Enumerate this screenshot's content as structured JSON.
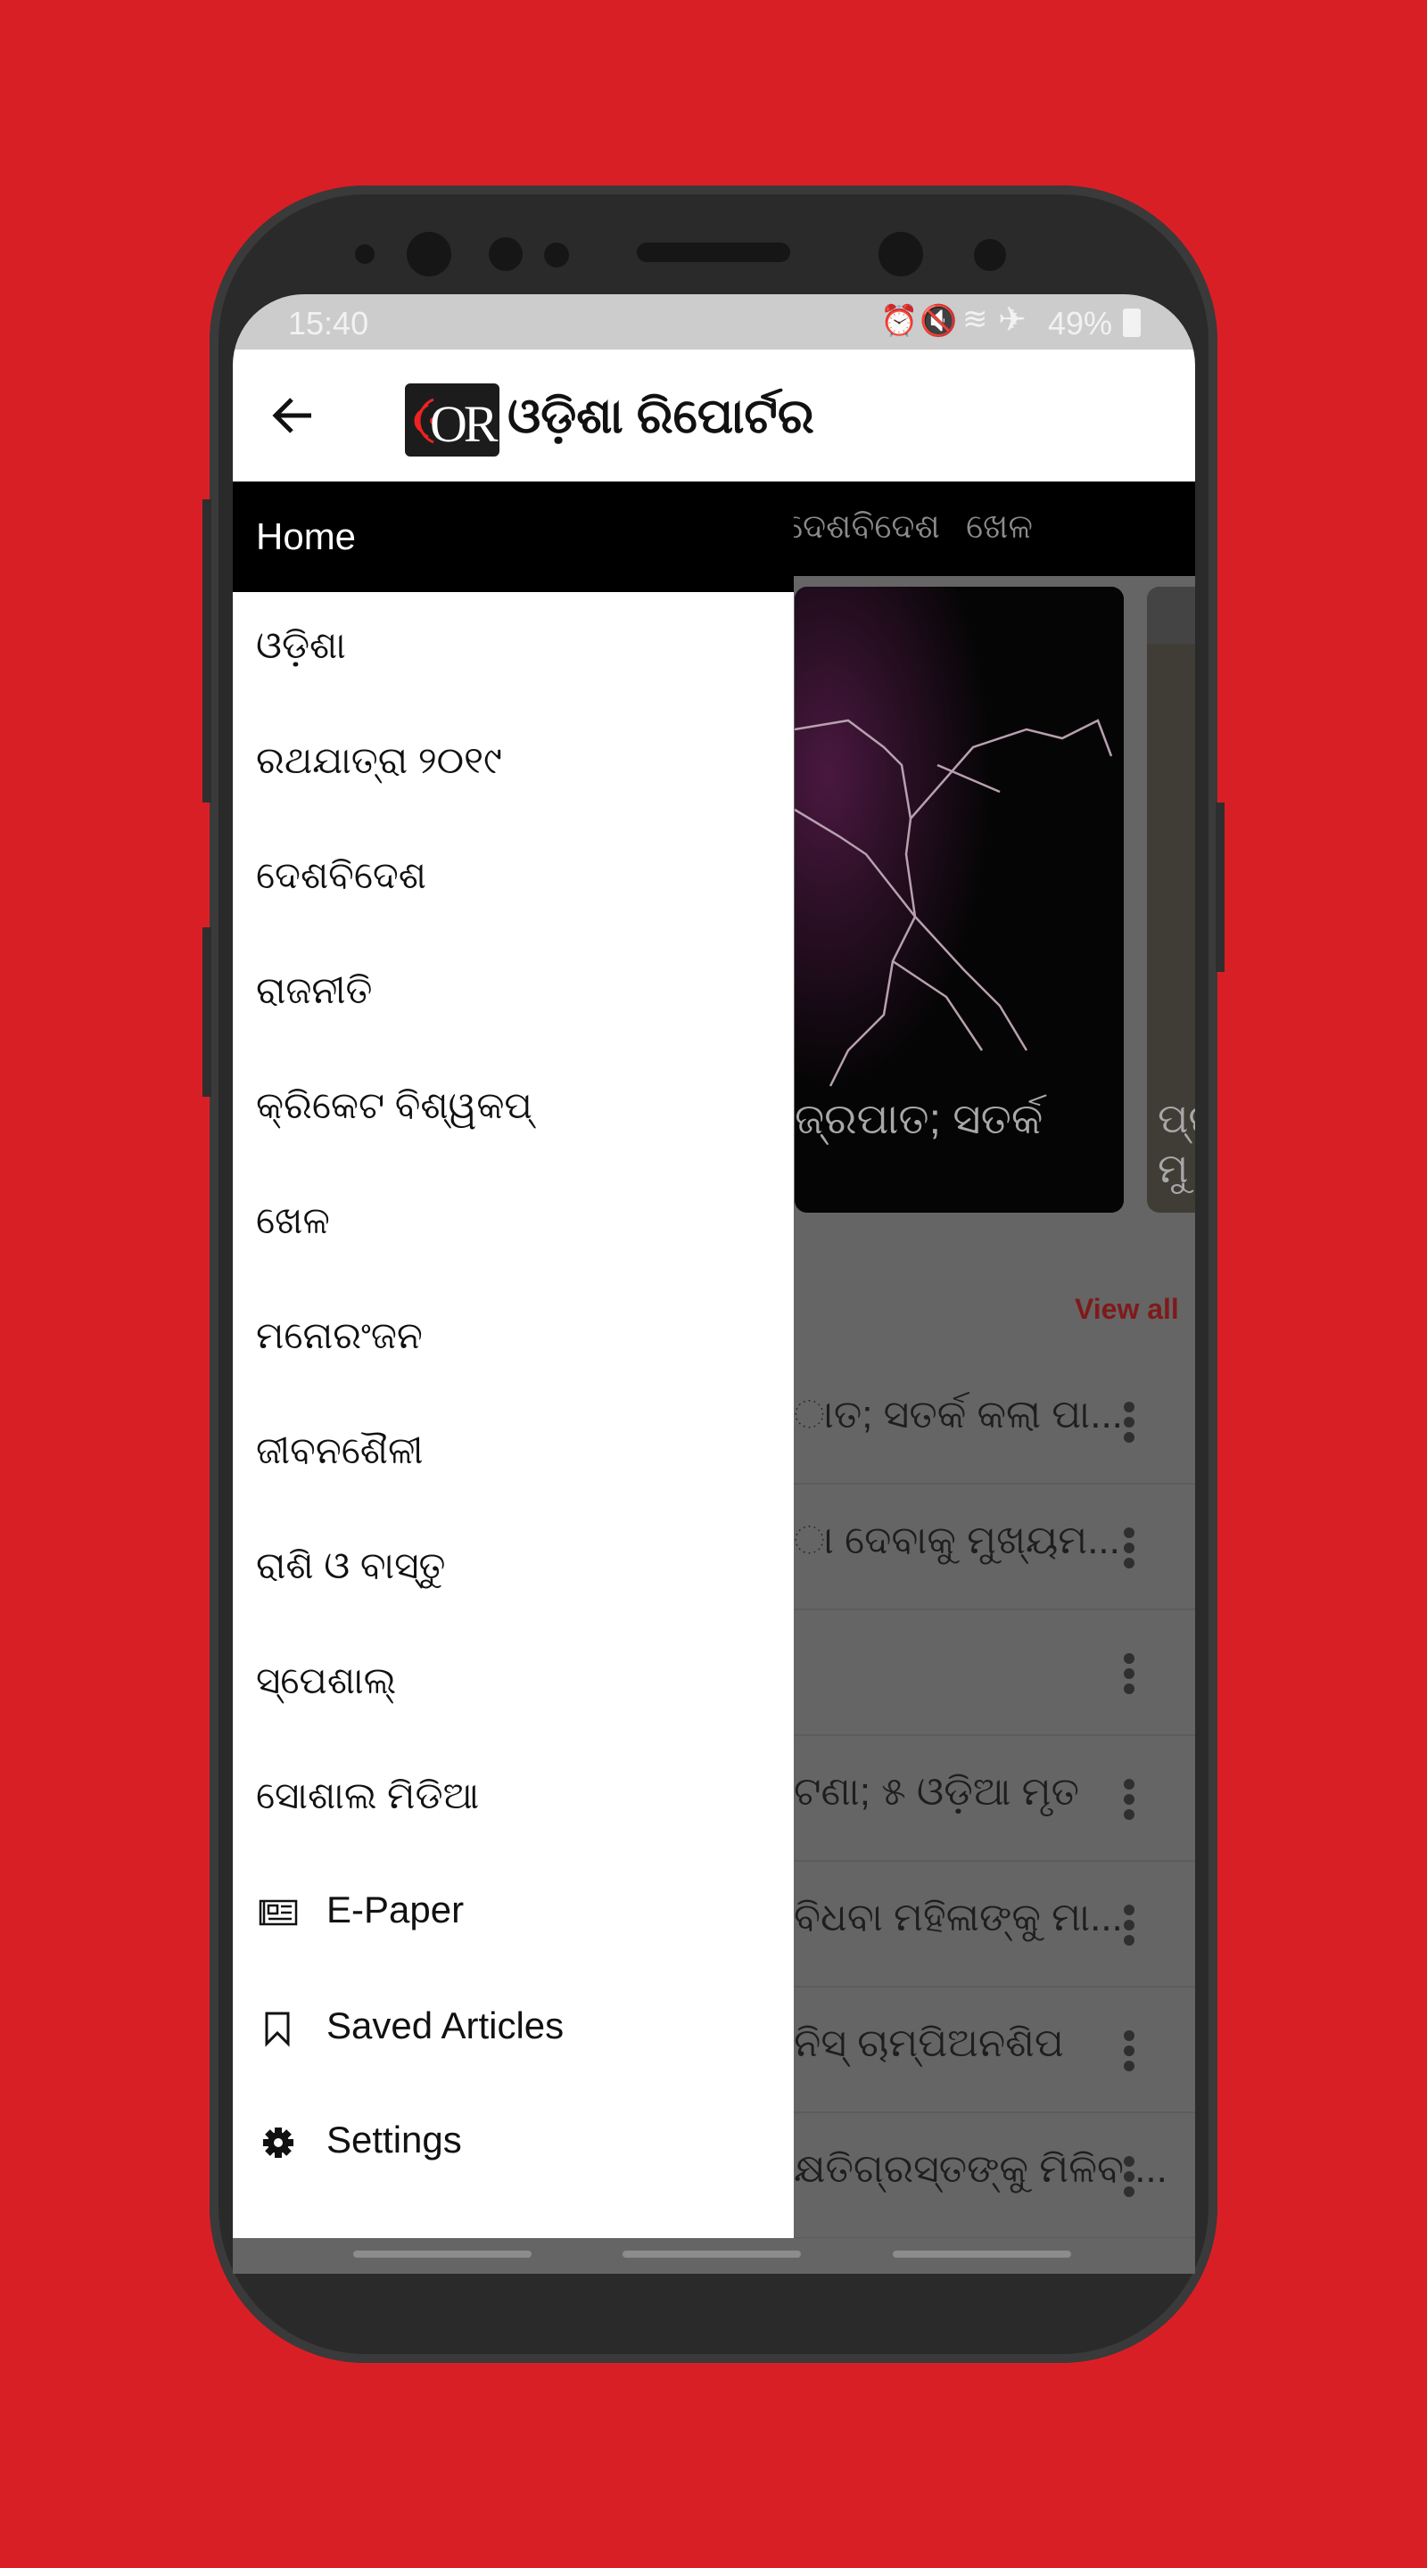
{
  "status_bar": {
    "time": "15:40",
    "battery": "49%",
    "icons": [
      "alarm-icon",
      "mute-icon",
      "wifi-icon",
      "airplane-icon",
      "battery-charging-icon"
    ]
  },
  "app_bar": {
    "back_icon": "arrow-left-icon",
    "logo_mark": "OR",
    "logo_text": "ଓଡ଼ିଶା ରିପୋର୍ଟର"
  },
  "tabs": [
    {
      "label": "ଦେଶବିଦେଶ"
    },
    {
      "label": "ଖେଳ"
    }
  ],
  "cards": [
    {
      "title": "ଜ୍ରପାତ; ସତର୍କ"
    },
    {
      "title": "ପ୍ର\nମୁ"
    }
  ],
  "section": {
    "view_all": "View all"
  },
  "articles": [
    {
      "title": "ାତ; ସତର୍କ କଲା ପା..."
    },
    {
      "title": "ା ଦେବାକୁ ମୁଖ୍ୟମ..."
    },
    {
      "title": ""
    },
    {
      "title": "ଟଣା; ୫ ଓଡ଼ିଆ ମୃତ"
    },
    {
      "title": "ବିଧବା ମହିଳାଙ୍କୁ ମା..."
    },
    {
      "title": "ନିସ୍ ଚାମ୍ପିଅନଶିପ"
    },
    {
      "title": "କ୍ଷତିଗ୍ରସ୍ତଙ୍କୁ ମିଳିବ ..."
    }
  ],
  "drawer": {
    "home": "Home",
    "categories": [
      {
        "label": "ଓଡ଼ିଶା"
      },
      {
        "label": "ରଥଯାତ୍ରା ୨୦୧୯"
      },
      {
        "label": "ଦେଶବିଦେଶ"
      },
      {
        "label": "ରାଜନୀତି"
      },
      {
        "label": "କ୍ରିକେଟ ବିଶ୍ୱକପ୍"
      },
      {
        "label": "ଖେଳ"
      },
      {
        "label": "ମନୋରଂଜନ"
      },
      {
        "label": "ଜୀବନଶୈଳୀ"
      },
      {
        "label": "ରାଶି ଓ ବାସ୍ତୁ"
      },
      {
        "label": "ସ୍ପେଶାଲ୍"
      },
      {
        "label": "ସୋଶାଲ ମିଡିଆ"
      }
    ],
    "actions": [
      {
        "label": "E-Paper",
        "icon": "newspaper-icon"
      },
      {
        "label": "Saved Articles",
        "icon": "bookmark-icon"
      },
      {
        "label": "Settings",
        "icon": "gear-icon"
      }
    ]
  },
  "colors": {
    "background": "#d91f26",
    "view_all": "#8a1a1a",
    "drawer_header": "#000000",
    "scrim": "#656565"
  }
}
